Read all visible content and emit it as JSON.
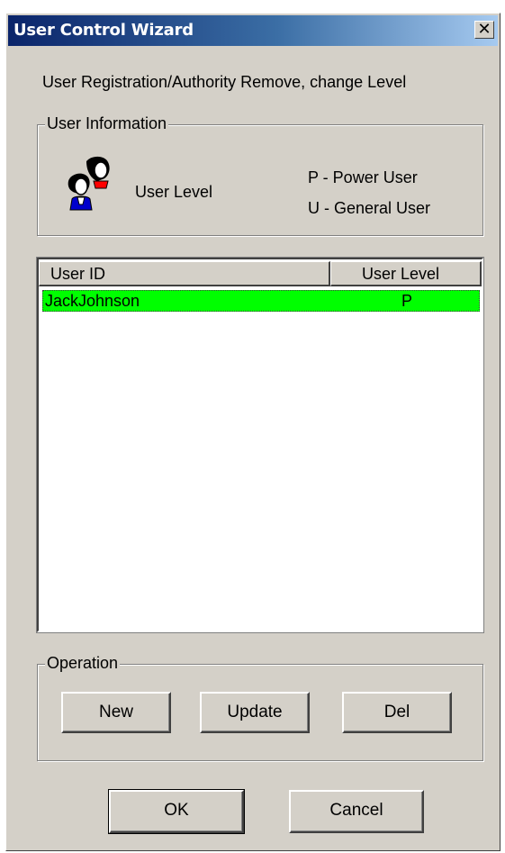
{
  "window": {
    "title": "User Control Wizard",
    "close_glyph": "✕"
  },
  "header_text": "User Registration/Authority  Remove, change Level",
  "user_info": {
    "legend": "User Information",
    "icon": "users-icon",
    "user_level_label": "User Level",
    "legend_p": "P - Power User",
    "legend_u": "U - General User"
  },
  "list": {
    "columns": [
      "User ID",
      "User Level"
    ],
    "rows": [
      {
        "user_id": "JackJohnson",
        "level": "P",
        "selected": true,
        "highlight_color": "#00ff00"
      }
    ]
  },
  "operation": {
    "legend": "Operation",
    "new_label": "New",
    "update_label": "Update",
    "del_label": "Del"
  },
  "footer": {
    "ok_label": "OK",
    "cancel_label": "Cancel"
  },
  "colors": {
    "dialog_bg": "#d4d0c8",
    "titlebar_start": "#0a246a",
    "titlebar_end": "#a6caf0",
    "selection": "#00ff00"
  }
}
